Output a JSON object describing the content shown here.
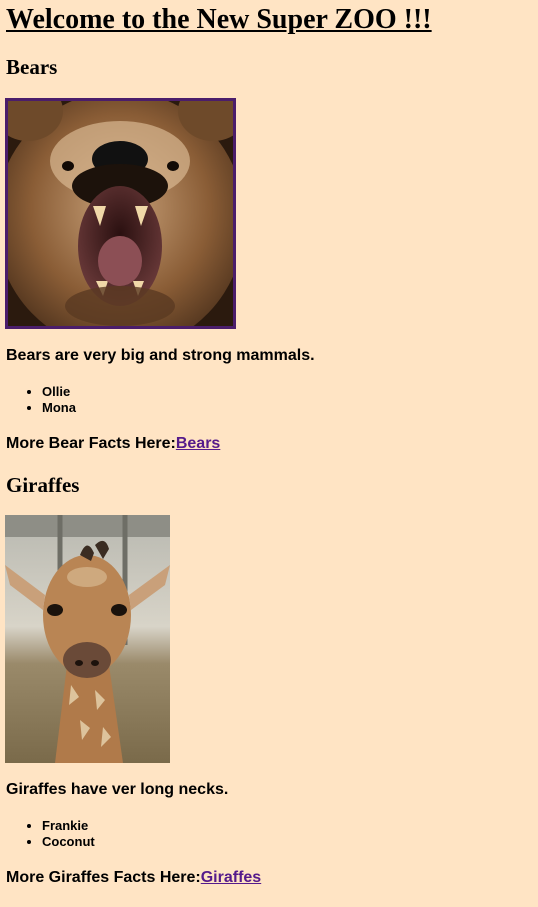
{
  "page": {
    "title": "Welcome to the New Super ZOO !!!"
  },
  "bears": {
    "heading": "Bears",
    "image_icon": "bear-photo",
    "description": "Bears are very big and strong mammals.",
    "names": [
      "Ollie",
      "Mona"
    ],
    "more_label": "More Bear Facts Here:",
    "link_text": "Bears"
  },
  "giraffes": {
    "heading": "Giraffes",
    "image_icon": "giraffe-photo",
    "description": "Giraffes have ver long necks.",
    "names": [
      "Frankie",
      "Coconut"
    ],
    "more_label": "More Giraffes Facts Here:",
    "link_text": "Giraffes"
  },
  "colors": {
    "background": "#ffe4c4",
    "link": "#551a8b",
    "bear_image_border": "#4b1d6b"
  }
}
